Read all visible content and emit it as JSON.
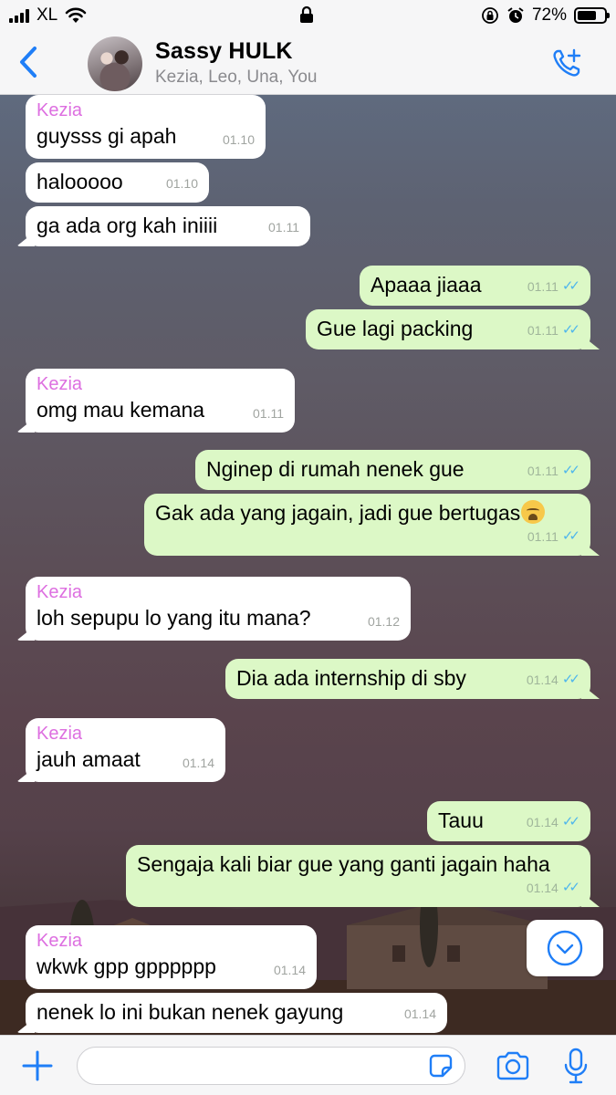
{
  "status_bar": {
    "carrier": "XL",
    "battery_label": "72%",
    "battery_level": 0.72
  },
  "header": {
    "back_icon": "chevron-left-icon",
    "title": "Sassy HULK",
    "subtitle": "Kezia, Leo, Una, You",
    "call_icon": "add-call-icon"
  },
  "messages": [
    {
      "direction": "in",
      "sender": "Kezia",
      "text": "guysss gi apah",
      "time": "01.10"
    },
    {
      "direction": "in",
      "sender": "",
      "text": "halooooo",
      "time": "01.10"
    },
    {
      "direction": "in",
      "sender": "",
      "text": "ga ada org kah iniiii",
      "time": "01.11"
    },
    {
      "direction": "out",
      "text": "Apaaa jiaaa",
      "time": "01.11",
      "read": true
    },
    {
      "direction": "out",
      "text": "Gue lagi packing",
      "time": "01.11",
      "read": true
    },
    {
      "direction": "in",
      "sender": "Kezia",
      "text": "omg mau kemana",
      "time": "01.11"
    },
    {
      "direction": "out",
      "text": "Nginep di rumah nenek gue",
      "time": "01.11",
      "read": true
    },
    {
      "direction": "out",
      "text": "Gak ada yang jagain, jadi gue bertugas",
      "emoji": "weary-face-emoji",
      "time": "01.11",
      "read": true
    },
    {
      "direction": "in",
      "sender": "Kezia",
      "text": "loh sepupu lo yang itu mana?",
      "time": "01.12"
    },
    {
      "direction": "out",
      "text": "Dia ada internship di sby",
      "time": "01.14",
      "read": true
    },
    {
      "direction": "in",
      "sender": "Kezia",
      "text": "jauh amaat",
      "time": "01.14"
    },
    {
      "direction": "out",
      "text": "Tauu",
      "time": "01.14",
      "read": true
    },
    {
      "direction": "out",
      "text": "Sengaja kali biar gue yang ganti jagain haha",
      "time": "01.14",
      "read": true
    },
    {
      "direction": "in",
      "sender": "Kezia",
      "text": "wkwk gpp gpppppp",
      "time": "01.14"
    },
    {
      "direction": "in",
      "sender": "",
      "text": "nenek lo ini bukan nenek gayung",
      "time": "01.14"
    }
  ],
  "input_bar": {
    "placeholder": "",
    "value": ""
  },
  "colors": {
    "sender": "#dd6fe0",
    "outgoing_bubble": "#dcf8c6",
    "accent": "#1f7ef7",
    "read_ticks": "#4fb6ec"
  }
}
